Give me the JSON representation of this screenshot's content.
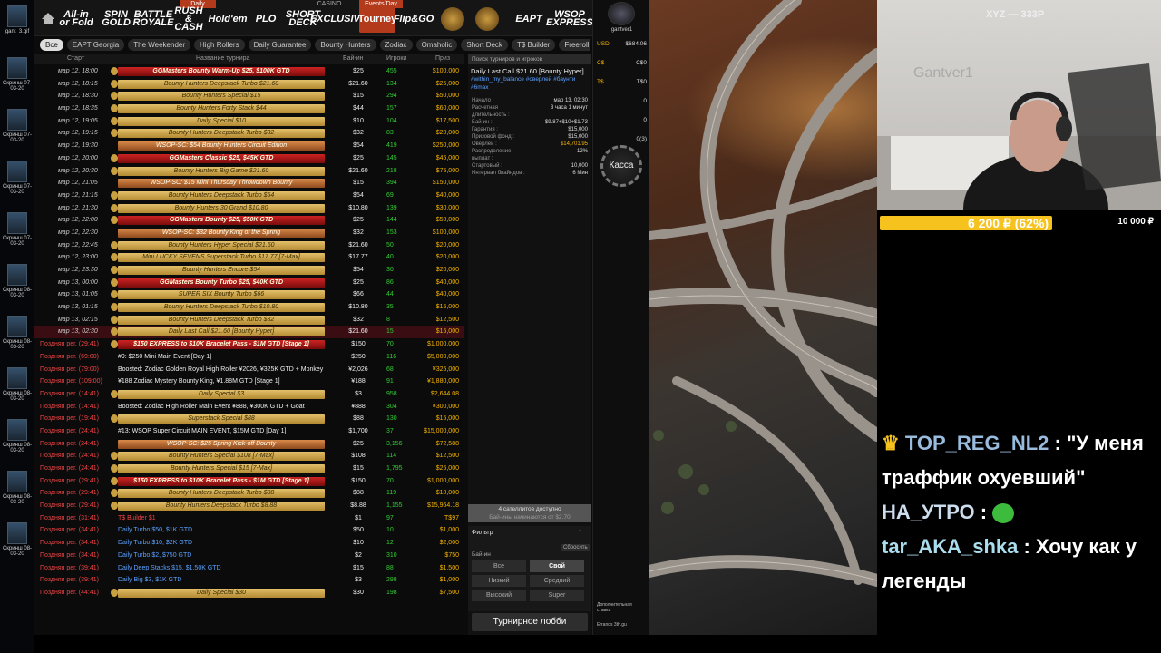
{
  "desktop": {
    "icons": [
      "gant_3.gif",
      "Скринш 07-03-20",
      "Скринш 07-03-20",
      "Скринш 07-03-20",
      "Скринш 07-03-20",
      "Скринш 08-03-20",
      "Скринш 08-03-20",
      "Скринш 08-03-20",
      "Скринш 08-03-20",
      "Скринш 08-03-20",
      "Скринш 08-03-20"
    ]
  },
  "nav": {
    "labels": {
      "daily": "Daily",
      "events": "Events/Day",
      "casino": "CASINO"
    },
    "tabs": [
      "All-in or Fold",
      "SPIN GOLD",
      "BATTLE ROYALE",
      "RUSH & CASH",
      "Hold'em",
      "PLO",
      "SHORT DECK",
      "EXCLUSIVE",
      "Tourney",
      "Flip&GO",
      "",
      "",
      "EAPT",
      "WSOP EXPRESS"
    ]
  },
  "filters": [
    "Все",
    "EAPT Georgia",
    "The Weekender",
    "High Rollers",
    "Daily Guarantee",
    "Bounty Hunters",
    "Zodiac",
    "Omaholic",
    "Short Deck",
    "T$ Builder",
    "Freeroll"
  ],
  "table": {
    "headers": {
      "start": "Старт",
      "name": "Название турнира",
      "buyin": "Бай-ин",
      "players": "Игроки",
      "prize": "Приз"
    },
    "rows": [
      {
        "t": "мар 12, 18:00",
        "n": "GGMasters Bounty Warm-Up $25, $100K GTD",
        "b": "$25",
        "p": "455",
        "z": "$100,000",
        "s": "red"
      },
      {
        "t": "мар 12, 18:15",
        "n": "Bounty Hunters Deepstack Turbo $21.60",
        "b": "$21.60",
        "p": "134",
        "z": "$25,000",
        "s": "gold"
      },
      {
        "t": "мар 12, 18:30",
        "n": "Bounty Hunters Special $15",
        "b": "$15",
        "p": "294",
        "z": "$50,000",
        "s": "gold"
      },
      {
        "t": "мар 12, 18:35",
        "n": "Bounty Hunters Forty Stack $44",
        "b": "$44",
        "p": "157",
        "z": "$60,000",
        "s": "gold"
      },
      {
        "t": "мар 12, 19:05",
        "n": "Daily Special $10",
        "b": "$10",
        "p": "104",
        "z": "$17,500",
        "s": "gold"
      },
      {
        "t": "мар 12, 19:15",
        "n": "Bounty Hunters Deepstack Turbo $32",
        "b": "$32",
        "p": "83",
        "z": "$20,000",
        "s": "gold"
      },
      {
        "t": "мар 12, 19:30",
        "n": "WSOP-SC: $54 Bounty Hunters Circuit Edition",
        "b": "$54",
        "p": "419",
        "z": "$250,000",
        "s": "orange"
      },
      {
        "t": "мар 12, 20:00",
        "n": "GGMasters Classic $25, $45K GTD",
        "b": "$25",
        "p": "145",
        "z": "$45,000",
        "s": "red"
      },
      {
        "t": "мар 12, 20:30",
        "n": "Bounty Hunters Big Game $21.60",
        "b": "$21.60",
        "p": "218",
        "z": "$75,000",
        "s": "gold"
      },
      {
        "t": "мар 12, 21:05",
        "n": "WSOP-SC: $15 Mini Thursday Throwdown Bounty",
        "b": "$15",
        "p": "394",
        "z": "$150,000",
        "s": "orange"
      },
      {
        "t": "мар 12, 21:15",
        "n": "Bounty Hunters Deepstack Turbo $54",
        "b": "$54",
        "p": "69",
        "z": "$40,000",
        "s": "gold"
      },
      {
        "t": "мар 12, 21:30",
        "n": "Bounty Hunters 30 Grand $10.80",
        "b": "$10.80",
        "p": "139",
        "z": "$30,000",
        "s": "gold"
      },
      {
        "t": "мар 12, 22:00",
        "n": "GGMasters Bounty $25, $50K GTD",
        "b": "$25",
        "p": "144",
        "z": "$50,000",
        "s": "red"
      },
      {
        "t": "мар 12, 22:30",
        "n": "WSOP-SC: $32 Bounty King of the Spring",
        "b": "$32",
        "p": "153",
        "z": "$100,000",
        "s": "orange"
      },
      {
        "t": "мар 12, 22:45",
        "n": "Bounty Hunters Hyper Special $21.60",
        "b": "$21.60",
        "p": "50",
        "z": "$20,000",
        "s": "gold"
      },
      {
        "t": "мар 12, 23:00",
        "n": "Mini LUCKY SEVENS Superstack Turbo $17.77 [7-Max]",
        "b": "$17.77",
        "p": "40",
        "z": "$20,000",
        "s": "gold"
      },
      {
        "t": "мар 12, 23:30",
        "n": "Bounty Hunters Encore $54",
        "b": "$54",
        "p": "30",
        "z": "$20,000",
        "s": "gold"
      },
      {
        "t": "мар 13, 00:00",
        "n": "GGMasters Bounty Turbo $25, $40K GTD",
        "b": "$25",
        "p": "86",
        "z": "$40,000",
        "s": "red"
      },
      {
        "t": "мар 13, 01:05",
        "n": "SUPER SIX Bounty Turbo $66",
        "b": "$66",
        "p": "44",
        "z": "$40,000",
        "s": "gold"
      },
      {
        "t": "мар 13, 01:15",
        "n": "Bounty Hunters Deepstack Turbo $10.80",
        "b": "$10.80",
        "p": "35",
        "z": "$15,000",
        "s": "gold"
      },
      {
        "t": "мар 13, 02:15",
        "n": "Bounty Hunters Deepstack Turbo $32",
        "b": "$32",
        "p": "8",
        "z": "$12,500",
        "s": "gold"
      },
      {
        "t": "мар 13, 02:30",
        "n": "Daily Last Call $21.60 [Bounty Hyper]",
        "b": "$21.60",
        "p": "15",
        "z": "$15,000",
        "s": "gold",
        "sel": true
      },
      {
        "t": "Поздняя рег. (29:41)",
        "n": "$150 EXPRESS to $10K Bracelet Pass - $1M GTD [Stage 1]",
        "b": "$150",
        "p": "70",
        "z": "$1,000,000",
        "s": "red",
        "late": true
      },
      {
        "t": "Поздняя рег. (69:00)",
        "n": "#9: $250 Mini Main Event [Day 1]",
        "b": "$250",
        "p": "116",
        "z": "$5,000,000",
        "s": "plain",
        "late": true
      },
      {
        "t": "Поздняя рег. (79:00)",
        "n": "Boosted: Zodiac Golden Royal High Roller ¥2026, ¥325K GTD + Monkey",
        "b": "¥2,026",
        "p": "68",
        "z": "¥325,000",
        "s": "plain",
        "late": true
      },
      {
        "t": "Поздняя рег. (109:00)",
        "n": "¥188 Zodiac Mystery Bounty King, ¥1.88M GTD [Stage 1]",
        "b": "¥188",
        "p": "91",
        "z": "¥1,880,000",
        "s": "plain",
        "late": true
      },
      {
        "t": "Поздняя рег. (14:41)",
        "n": "Daily Special $3",
        "b": "$3",
        "p": "958",
        "z": "$2,644.08",
        "s": "gold",
        "late": true
      },
      {
        "t": "Поздняя рег. (14:41)",
        "n": "Boosted: Zodiac High Roller Main Event ¥888, ¥300K GTD + Goat",
        "b": "¥888",
        "p": "304",
        "z": "¥300,000",
        "s": "plain",
        "late": true
      },
      {
        "t": "Поздняя рег. (19:41)",
        "n": "Superstack Special $88",
        "b": "$88",
        "p": "130",
        "z": "$15,000",
        "s": "gold",
        "late": true
      },
      {
        "t": "Поздняя рег. (24:41)",
        "n": "#13: WSOP Super Circuit MAIN EVENT, $15M GTD [Day 1]",
        "b": "$1,700",
        "p": "37",
        "z": "$15,000,000",
        "s": "plain",
        "late": true
      },
      {
        "t": "Поздняя рег. (24:41)",
        "n": "WSOP-SC: $25 Spring Kick-off Bounty",
        "b": "$25",
        "p": "3,156",
        "z": "$72,588",
        "s": "orange",
        "late": true
      },
      {
        "t": "Поздняя рег. (24:41)",
        "n": "Bounty Hunters Special $108 [7-Max]",
        "b": "$108",
        "p": "114",
        "z": "$12,500",
        "s": "gold",
        "late": true
      },
      {
        "t": "Поздняя рег. (24:41)",
        "n": "Bounty Hunters Special $15 [7-Max]",
        "b": "$15",
        "p": "1,795",
        "z": "$25,000",
        "s": "gold",
        "late": true
      },
      {
        "t": "Поздняя рег. (29:41)",
        "n": "$150 EXPRESS to $10K Bracelet Pass - $1M GTD [Stage 1]",
        "b": "$150",
        "p": "70",
        "z": "$1,000,000",
        "s": "red",
        "late": true
      },
      {
        "t": "Поздняя рег. (29:41)",
        "n": "Bounty Hunters Deepstack Turbo $88",
        "b": "$88",
        "p": "119",
        "z": "$10,000",
        "s": "gold",
        "late": true
      },
      {
        "t": "Поздняя рег. (29:41)",
        "n": "Bounty Hunters Deepstack Turbo $8.88",
        "b": "$8.88",
        "p": "1,155",
        "z": "$15,964.18",
        "s": "gold",
        "late": true
      },
      {
        "t": "Поздняя рег. (31:41)",
        "n": "T$ Builder $1",
        "b": "$1",
        "p": "97",
        "z": "T$97",
        "s": "plainred",
        "late": true
      },
      {
        "t": "Поздняя рег. (34:41)",
        "n": "Daily Turbo $50, $1K GTD",
        "b": "$50",
        "p": "10",
        "z": "$1,000",
        "s": "plainblue",
        "late": true
      },
      {
        "t": "Поздняя рег. (34:41)",
        "n": "Daily Turbo $10, $2K GTD",
        "b": "$10",
        "p": "12",
        "z": "$2,000",
        "s": "plainblue",
        "late": true
      },
      {
        "t": "Поздняя рег. (34:41)",
        "n": "Daily Turbo $2, $750 GTD",
        "b": "$2",
        "p": "310",
        "z": "$750",
        "s": "plainblue",
        "late": true
      },
      {
        "t": "Поздняя рег. (39:41)",
        "n": "Daily Deep Stacks $15, $1.50K GTD",
        "b": "$15",
        "p": "88",
        "z": "$1,500",
        "s": "plainblue",
        "late": true
      },
      {
        "t": "Поздняя рег. (39:41)",
        "n": "Daily Big $3, $1K GTD",
        "b": "$3",
        "p": "298",
        "z": "$1,000",
        "s": "plainblue",
        "late": true
      },
      {
        "t": "Поздняя рег. (44:41)",
        "n": "Daily Special $30",
        "b": "$30",
        "p": "198",
        "z": "$7,500",
        "s": "gold",
        "late": true
      }
    ]
  },
  "info": {
    "search_placeholder": "Поиск турниров и игроков",
    "title": "Daily Last Call $21.60 [Bounty Hyper]",
    "tags": "#within_my_balance #оверлей #баунти #6max",
    "fields": [
      {
        "k": "Начало :",
        "v": "мар 13, 02:30"
      },
      {
        "k": "Расчетная длительность :",
        "v": "3 часа 1 минут"
      },
      {
        "k": "Бай-ин :",
        "v": "$9.87+$10+$1.73"
      },
      {
        "k": "Гарантия :",
        "v": "$15,000"
      },
      {
        "k": "Призовой фонд :",
        "v": "$15,000"
      },
      {
        "k": "Оверлей :",
        "v": "$14,701.95",
        "gold": true
      },
      {
        "k": "Распределение выплат :",
        "v": "12%"
      },
      {
        "k": "Стартовый :",
        "v": "10,000"
      },
      {
        "k": "Интервал блайндов :",
        "v": "6 Мин"
      }
    ],
    "satellites": "4 сателлитов доступно",
    "satellites_sub": "Бай-ины начинаются от $2.70",
    "filter_title": "Фильтр",
    "buyin_label": "Бай-ин",
    "reset": "Сбросить",
    "filter_buttons": [
      "Все",
      "Свой",
      "Низкий",
      "Средний",
      "Высокий",
      "Super"
    ],
    "lobby_button": "Турнирное лобби"
  },
  "balance": {
    "username": "gantver1",
    "rows": [
      {
        "k": "USD",
        "v": "$684.06"
      },
      {
        "k": "C$",
        "v": "C$0"
      },
      {
        "k": "T$",
        "v": "T$0"
      },
      {
        "k": "",
        "v": "0"
      },
      {
        "k": "",
        "v": "0"
      },
      {
        "k": "",
        "v": "0(3)"
      }
    ],
    "cashier": "Касса",
    "promo1": "Дополнительная ставка",
    "promo2": "Errands 3th.gu"
  },
  "webcam": {
    "tag": "XYZ — 333P",
    "watermark": "Gantver1"
  },
  "donation": {
    "current": "6 200 ₽ (62%)",
    "goal": "10 000 ₽",
    "percent": 62,
    "color": "#f6c21d"
  },
  "chat": [
    {
      "user": "TOP_REG_NL2",
      "text": ": \"У меня траффик охуевший\""
    },
    {
      "user": "НА_УТРО",
      "text": ":"
    },
    {
      "user": "tar_AKA_shka",
      "text": ": Хочу как у легенды"
    }
  ]
}
